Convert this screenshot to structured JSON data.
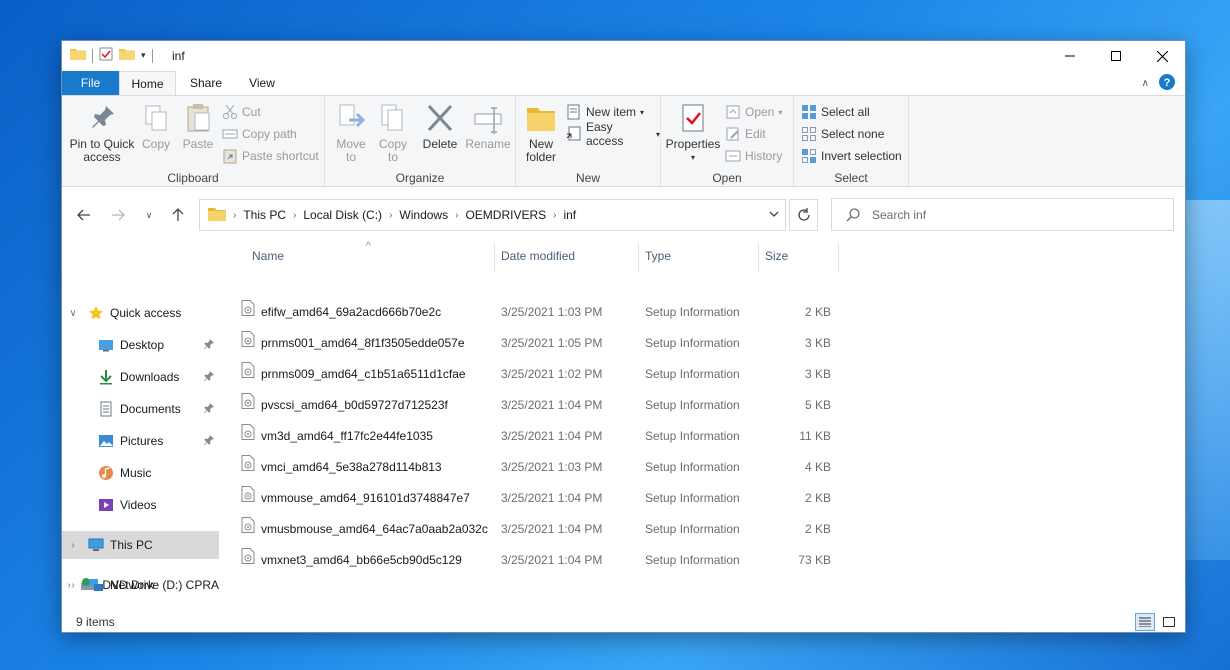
{
  "window": {
    "title": "inf"
  },
  "tabs": {
    "file": "File",
    "home": "Home",
    "share": "Share",
    "view": "View"
  },
  "ribbon": {
    "clipboard": {
      "pin": "Pin to Quick",
      "pin2": "access",
      "copy": "Copy",
      "paste": "Paste",
      "cut": "Cut",
      "copy_path": "Copy path",
      "paste_shortcut": "Paste shortcut",
      "label": "Clipboard"
    },
    "organize": {
      "move": "Move",
      "move2": "to",
      "copyto": "Copy",
      "copyto2": "to",
      "delete": "Delete",
      "rename": "Rename",
      "label": "Organize"
    },
    "new": {
      "new_folder": "New",
      "new_folder2": "folder",
      "new_item": "New item",
      "easy_access": "Easy access",
      "label": "New"
    },
    "open": {
      "properties": "Properties",
      "open": "Open",
      "edit": "Edit",
      "history": "History",
      "label": "Open"
    },
    "select": {
      "select_all": "Select all",
      "select_none": "Select none",
      "invert": "Invert selection",
      "label": "Select"
    }
  },
  "address": {
    "crumbs": [
      "This PC",
      "Local Disk (C:)",
      "Windows",
      "OEMDRIVERS",
      "inf"
    ],
    "search_placeholder": "Search inf"
  },
  "nav": {
    "quick_access": "Quick access",
    "desktop": "Desktop",
    "downloads": "Downloads",
    "documents": "Documents",
    "pictures": "Pictures",
    "music": "Music",
    "videos": "Videos",
    "this_pc": "This PC",
    "dvd": "DVD Drive (D:) CPRA",
    "network": "Network"
  },
  "columns": {
    "name": "Name",
    "date": "Date modified",
    "type": "Type",
    "size": "Size"
  },
  "files": [
    {
      "name": "efifw_amd64_69a2acd666b70e2c",
      "date": "3/25/2021 1:03 PM",
      "type": "Setup Information",
      "size": "2 KB"
    },
    {
      "name": "prnms001_amd64_8f1f3505edde057e",
      "date": "3/25/2021 1:05 PM",
      "type": "Setup Information",
      "size": "3 KB"
    },
    {
      "name": "prnms009_amd64_c1b51a6511d1cfae",
      "date": "3/25/2021 1:02 PM",
      "type": "Setup Information",
      "size": "3 KB"
    },
    {
      "name": "pvscsi_amd64_b0d59727d712523f",
      "date": "3/25/2021 1:04 PM",
      "type": "Setup Information",
      "size": "5 KB"
    },
    {
      "name": "vm3d_amd64_ff17fc2e44fe1035",
      "date": "3/25/2021 1:04 PM",
      "type": "Setup Information",
      "size": "11 KB"
    },
    {
      "name": "vmci_amd64_5e38a278d114b813",
      "date": "3/25/2021 1:03 PM",
      "type": "Setup Information",
      "size": "4 KB"
    },
    {
      "name": "vmmouse_amd64_916101d3748847e7",
      "date": "3/25/2021 1:04 PM",
      "type": "Setup Information",
      "size": "2 KB"
    },
    {
      "name": "vmusbmouse_amd64_64ac7a0aab2a032c",
      "date": "3/25/2021 1:04 PM",
      "type": "Setup Information",
      "size": "2 KB"
    },
    {
      "name": "vmxnet3_amd64_bb66e5cb90d5c129",
      "date": "3/25/2021 1:04 PM",
      "type": "Setup Information",
      "size": "73 KB"
    }
  ],
  "status": {
    "items": "9 items"
  },
  "colors": {
    "accent": "#1979ca",
    "selected_nav": "#d9d9d9"
  }
}
